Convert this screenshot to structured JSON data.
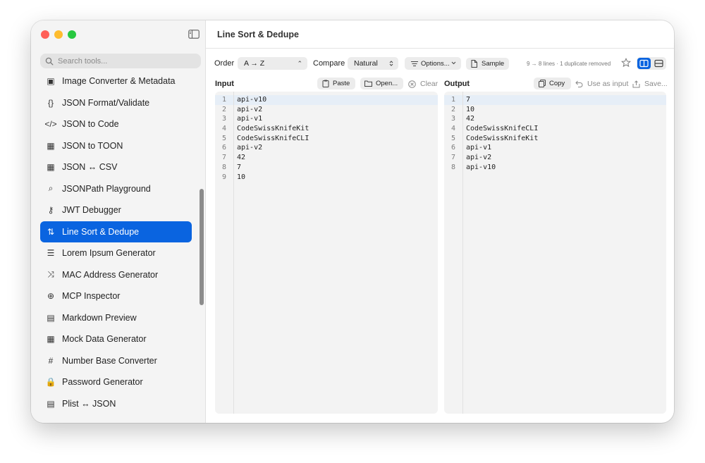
{
  "window": {
    "title": "Line Sort & Dedupe"
  },
  "sidebar": {
    "search_placeholder": "Search tools...",
    "items": [
      {
        "label": "Image Converter & Metadata",
        "icon": "image-icon",
        "glyph": "▣"
      },
      {
        "label": "JSON Format/Validate",
        "icon": "braces-icon",
        "glyph": "{}"
      },
      {
        "label": "JSON to Code",
        "icon": "code-icon",
        "glyph": "</>"
      },
      {
        "label": "JSON to TOON",
        "icon": "table-icon",
        "glyph": "▦"
      },
      {
        "label": "JSON ↔ CSV",
        "icon": "table-icon",
        "glyph": "▦"
      },
      {
        "label": "JSONPath Playground",
        "icon": "magnifier-icon",
        "glyph": "⌕"
      },
      {
        "label": "JWT Debugger",
        "icon": "key-icon",
        "glyph": "⚷"
      },
      {
        "label": "Line Sort & Dedupe",
        "icon": "sort-arrows-icon",
        "glyph": "⇅",
        "active": true
      },
      {
        "label": "Lorem Ipsum Generator",
        "icon": "text-lines-icon",
        "glyph": "☰"
      },
      {
        "label": "MAC Address Generator",
        "icon": "shuffle-icon",
        "glyph": "⤨"
      },
      {
        "label": "MCP Inspector",
        "icon": "globe-icon",
        "glyph": "⊕"
      },
      {
        "label": "Markdown Preview",
        "icon": "document-icon",
        "glyph": "▤"
      },
      {
        "label": "Mock Data Generator",
        "icon": "table-icon",
        "glyph": "▦"
      },
      {
        "label": "Number Base Converter",
        "icon": "hash-icon",
        "glyph": "#"
      },
      {
        "label": "Password Generator",
        "icon": "lock-icon",
        "glyph": "🔒"
      },
      {
        "label": "Plist ↔ JSON",
        "icon": "list-window-icon",
        "glyph": "▤"
      }
    ]
  },
  "toolbar": {
    "order_label": "Order",
    "order_value": "A → Z",
    "compare_label": "Compare",
    "compare_value": "Natural",
    "options_label": "Options...",
    "sample_label": "Sample",
    "status": "9 → 8 lines · 1 duplicate removed"
  },
  "input_pane": {
    "title": "Input",
    "paste_label": "Paste",
    "open_label": "Open...",
    "clear_label": "Clear",
    "lines": [
      "api-v10",
      "api-v2",
      "api-v1",
      "CodeSwissKnifeKit",
      "CodeSwissKnifeCLI",
      "api-v2",
      "42",
      "7",
      "10"
    ]
  },
  "output_pane": {
    "title": "Output",
    "copy_label": "Copy",
    "use_as_input_label": "Use as input",
    "save_label": "Save...",
    "lines": [
      "7",
      "10",
      "42",
      "CodeSwissKnifeCLI",
      "CodeSwissKnifeKit",
      "api-v1",
      "api-v2",
      "api-v10"
    ]
  },
  "colors": {
    "accent": "#0a64e0",
    "traffic_red": "#ff5f57",
    "traffic_yellow": "#febc2e",
    "traffic_green": "#28c840"
  }
}
